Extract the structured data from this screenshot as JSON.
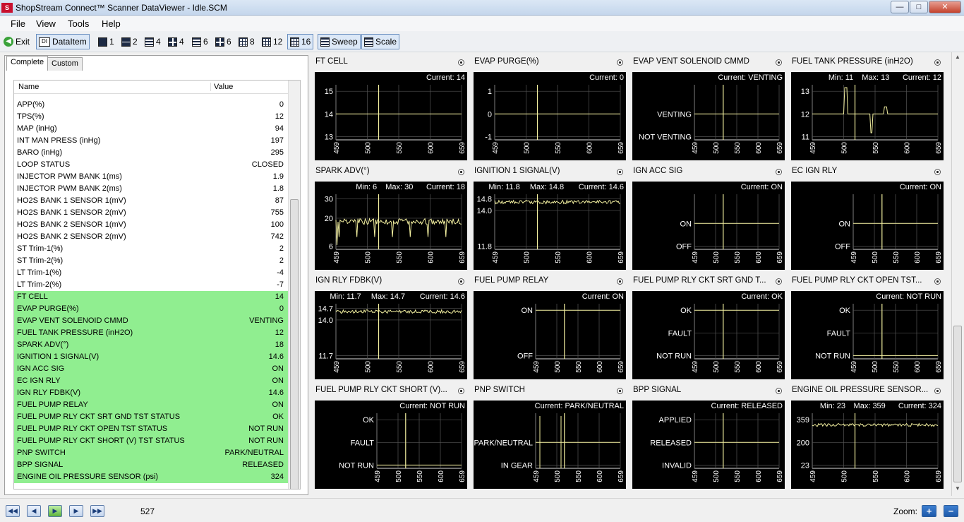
{
  "window": {
    "title": "ShopStream Connect™ Scanner DataViewer - Idle.SCM",
    "logo": "S",
    "min": "—",
    "max": "□",
    "close": "✕"
  },
  "menu": [
    "File",
    "View",
    "Tools",
    "Help"
  ],
  "toolbar": {
    "exit": "Exit",
    "dataitem": "DataItem",
    "layouts": [
      "1",
      "2",
      "4",
      "4",
      "6",
      "6",
      "8",
      "12",
      "16"
    ],
    "sweep": "Sweep",
    "scale": "Scale"
  },
  "tabs": {
    "complete": "Complete",
    "custom": "Custom"
  },
  "list": {
    "headers": {
      "name": "Name",
      "value": "Value"
    },
    "rows": [
      {
        "name": "APP(%)",
        "value": "0"
      },
      {
        "name": "TPS(%)",
        "value": "12"
      },
      {
        "name": "MAP (inHg)",
        "value": "94"
      },
      {
        "name": "INT MAN PRESS (inHg)",
        "value": "197"
      },
      {
        "name": "BARO (inHg)",
        "value": "295"
      },
      {
        "name": "LOOP STATUS",
        "value": "CLOSED"
      },
      {
        "name": "INJECTOR PWM BANK 1(ms)",
        "value": "1.9"
      },
      {
        "name": "INJECTOR PWM BANK 2(ms)",
        "value": "1.8"
      },
      {
        "name": "HO2S BANK 1 SENSOR 1(mV)",
        "value": "87"
      },
      {
        "name": "HO2S BANK 1 SENSOR 2(mV)",
        "value": "755"
      },
      {
        "name": "HO2S BANK 2 SENSOR 1(mV)",
        "value": "100"
      },
      {
        "name": "HO2S BANK 2 SENSOR 2(mV)",
        "value": "742"
      },
      {
        "name": "ST Trim-1(%)",
        "value": "2"
      },
      {
        "name": "ST Trim-2(%)",
        "value": "2"
      },
      {
        "name": "LT Trim-1(%)",
        "value": "-4"
      },
      {
        "name": "LT Trim-2(%)",
        "value": "-7"
      },
      {
        "name": "FT CELL",
        "value": "14",
        "hl": true
      },
      {
        "name": "EVAP PURGE(%)",
        "value": "0",
        "hl": true
      },
      {
        "name": "EVAP VENT SOLENOID CMMD",
        "value": "VENTING",
        "hl": true
      },
      {
        "name": "FUEL TANK PRESSURE  (inH2O)",
        "value": "12",
        "hl": true
      },
      {
        "name": "SPARK ADV(°)",
        "value": "18",
        "hl": true
      },
      {
        "name": "IGNITION 1 SIGNAL(V)",
        "value": "14.6",
        "hl": true
      },
      {
        "name": "IGN ACC SIG",
        "value": "ON",
        "hl": true
      },
      {
        "name": "EC IGN RLY",
        "value": "ON",
        "hl": true
      },
      {
        "name": "IGN RLY FDBK(V)",
        "value": "14.6",
        "hl": true
      },
      {
        "name": "FUEL PUMP RELAY",
        "value": "ON",
        "hl": true
      },
      {
        "name": "FUEL PUMP RLY CKT SRT GND TST STATUS",
        "value": "OK",
        "hl": true
      },
      {
        "name": "FUEL PUMP RLY CKT OPEN TST STATUS",
        "value": "NOT RUN",
        "hl": true
      },
      {
        "name": "FUEL PUMP RLY CKT SHORT (V) TST STATUS",
        "value": "NOT RUN",
        "hl": true
      },
      {
        "name": "PNP SWITCH",
        "value": "PARK/NEUTRAL",
        "hl": true
      },
      {
        "name": "BPP SIGNAL",
        "value": "RELEASED",
        "hl": true
      },
      {
        "name": "ENGINE OIL PRESSURE SENSOR (psi)",
        "value": "324",
        "hl": true
      }
    ]
  },
  "chart_data": [
    {
      "title": "FT CELL",
      "type": "line",
      "current": "Current: 14",
      "yticks": [
        "15",
        "14",
        "13"
      ],
      "level": 0.5,
      "style": "flat"
    },
    {
      "title": "EVAP PURGE(%)",
      "type": "line",
      "current": "Current: 0",
      "yticks": [
        "1",
        "0",
        "-1"
      ],
      "level": 0.5,
      "style": "flat"
    },
    {
      "title": "EVAP VENT SOLENOID CMMD",
      "type": "line",
      "current": "Current: VENTING",
      "yticks": [
        "VENTING",
        "NOT VENTING"
      ],
      "ypos": [
        0.5,
        0.85
      ],
      "level": 0.5,
      "style": "flat"
    },
    {
      "title": "FUEL TANK PRESSURE  (inH2O)",
      "type": "line",
      "min": "Min: 11",
      "max": "Max: 13",
      "current": "Current: 12",
      "yticks": [
        "13",
        "12",
        "11"
      ],
      "level": 0.5,
      "style": "steps"
    },
    {
      "title": "SPARK ADV(°)",
      "type": "line",
      "min": "Min: 6",
      "max": "Max: 30",
      "current": "Current: 18",
      "yticks": [
        "30",
        "20",
        "6"
      ],
      "ypos": [
        0.12,
        0.42,
        0.85
      ],
      "level": 0.47,
      "style": "noisy-deep"
    },
    {
      "title": "IGNITION 1 SIGNAL(V)",
      "type": "line",
      "min": "Min: 11.8",
      "max": "Max: 14.8",
      "current": "Current: 14.6",
      "yticks": [
        "14.8",
        "14.0",
        "11.8"
      ],
      "ypos": [
        0.12,
        0.3,
        0.85
      ],
      "level": 0.17,
      "style": "noisy"
    },
    {
      "title": "IGN ACC SIG",
      "type": "line",
      "current": "Current: ON",
      "yticks": [
        "ON",
        "OFF"
      ],
      "ypos": [
        0.5,
        0.85
      ],
      "level": 0.5,
      "style": "flat"
    },
    {
      "title": "EC IGN RLY",
      "type": "line",
      "current": "Current: ON",
      "yticks": [
        "ON",
        "OFF"
      ],
      "ypos": [
        0.5,
        0.85
      ],
      "level": 0.5,
      "style": "flat"
    },
    {
      "title": "IGN RLY FDBK(V)",
      "type": "line",
      "min": "Min: 11.7",
      "max": "Max: 14.7",
      "current": "Current: 14.6",
      "yticks": [
        "14.7",
        "14.0",
        "11.7"
      ],
      "ypos": [
        0.12,
        0.3,
        0.85
      ],
      "level": 0.17,
      "style": "noisy"
    },
    {
      "title": "FUEL PUMP RELAY",
      "type": "line",
      "current": "Current: ON",
      "yticks": [
        "ON",
        "OFF"
      ],
      "ypos": [
        0.15,
        0.85
      ],
      "level": 0.15,
      "style": "flat"
    },
    {
      "title": "FUEL PUMP RLY CKT SRT GND T...",
      "type": "line",
      "current": "Current: OK",
      "yticks": [
        "OK",
        "FAULT",
        "NOT RUN"
      ],
      "ypos": [
        0.15,
        0.5,
        0.85
      ],
      "level": 0.15,
      "style": "flat"
    },
    {
      "title": "FUEL PUMP RLY CKT OPEN TST...",
      "type": "line",
      "current": "Current: NOT RUN",
      "yticks": [
        "OK",
        "FAULT",
        "NOT RUN"
      ],
      "ypos": [
        0.15,
        0.5,
        0.85
      ],
      "level": 0.85,
      "style": "flat"
    },
    {
      "title": "FUEL PUMP RLY CKT SHORT (V)...",
      "type": "line",
      "current": "Current: NOT RUN",
      "yticks": [
        "OK",
        "FAULT",
        "NOT RUN"
      ],
      "ypos": [
        0.15,
        0.5,
        0.85
      ],
      "level": 0.85,
      "style": "flat"
    },
    {
      "title": "PNP SWITCH",
      "type": "line",
      "current": "Current: PARK/NEUTRAL",
      "yticks": [
        "PARK/NEUTRAL",
        "IN GEAR"
      ],
      "ypos": [
        0.5,
        0.85
      ],
      "level": 0.5,
      "style": "pnp"
    },
    {
      "title": "BPP SIGNAL",
      "type": "line",
      "current": "Current: RELEASED",
      "yticks": [
        "APPLIED",
        "RELEASED",
        "INVALID"
      ],
      "ypos": [
        0.15,
        0.5,
        0.85
      ],
      "level": 0.5,
      "style": "flat"
    },
    {
      "title": "ENGINE OIL PRESSURE SENSOR...",
      "type": "line",
      "min": "Min: 23",
      "max": "Max: 359",
      "current": "Current: 324",
      "yticks": [
        "359",
        "200",
        "23"
      ],
      "ypos": [
        0.15,
        0.5,
        0.85
      ],
      "level": 0.23,
      "style": "noisy-light"
    }
  ],
  "xticks": [
    "459",
    "500",
    "550",
    "600",
    "659"
  ],
  "cursor_fraction": 0.34,
  "bottom": {
    "frame": "527",
    "zoom": "Zoom:",
    "zoom_in": "+",
    "zoom_out": "−"
  },
  "colors": {
    "trace": "#f3f0a0",
    "highlight": "#90ee90",
    "chart_bg": "#000000"
  }
}
